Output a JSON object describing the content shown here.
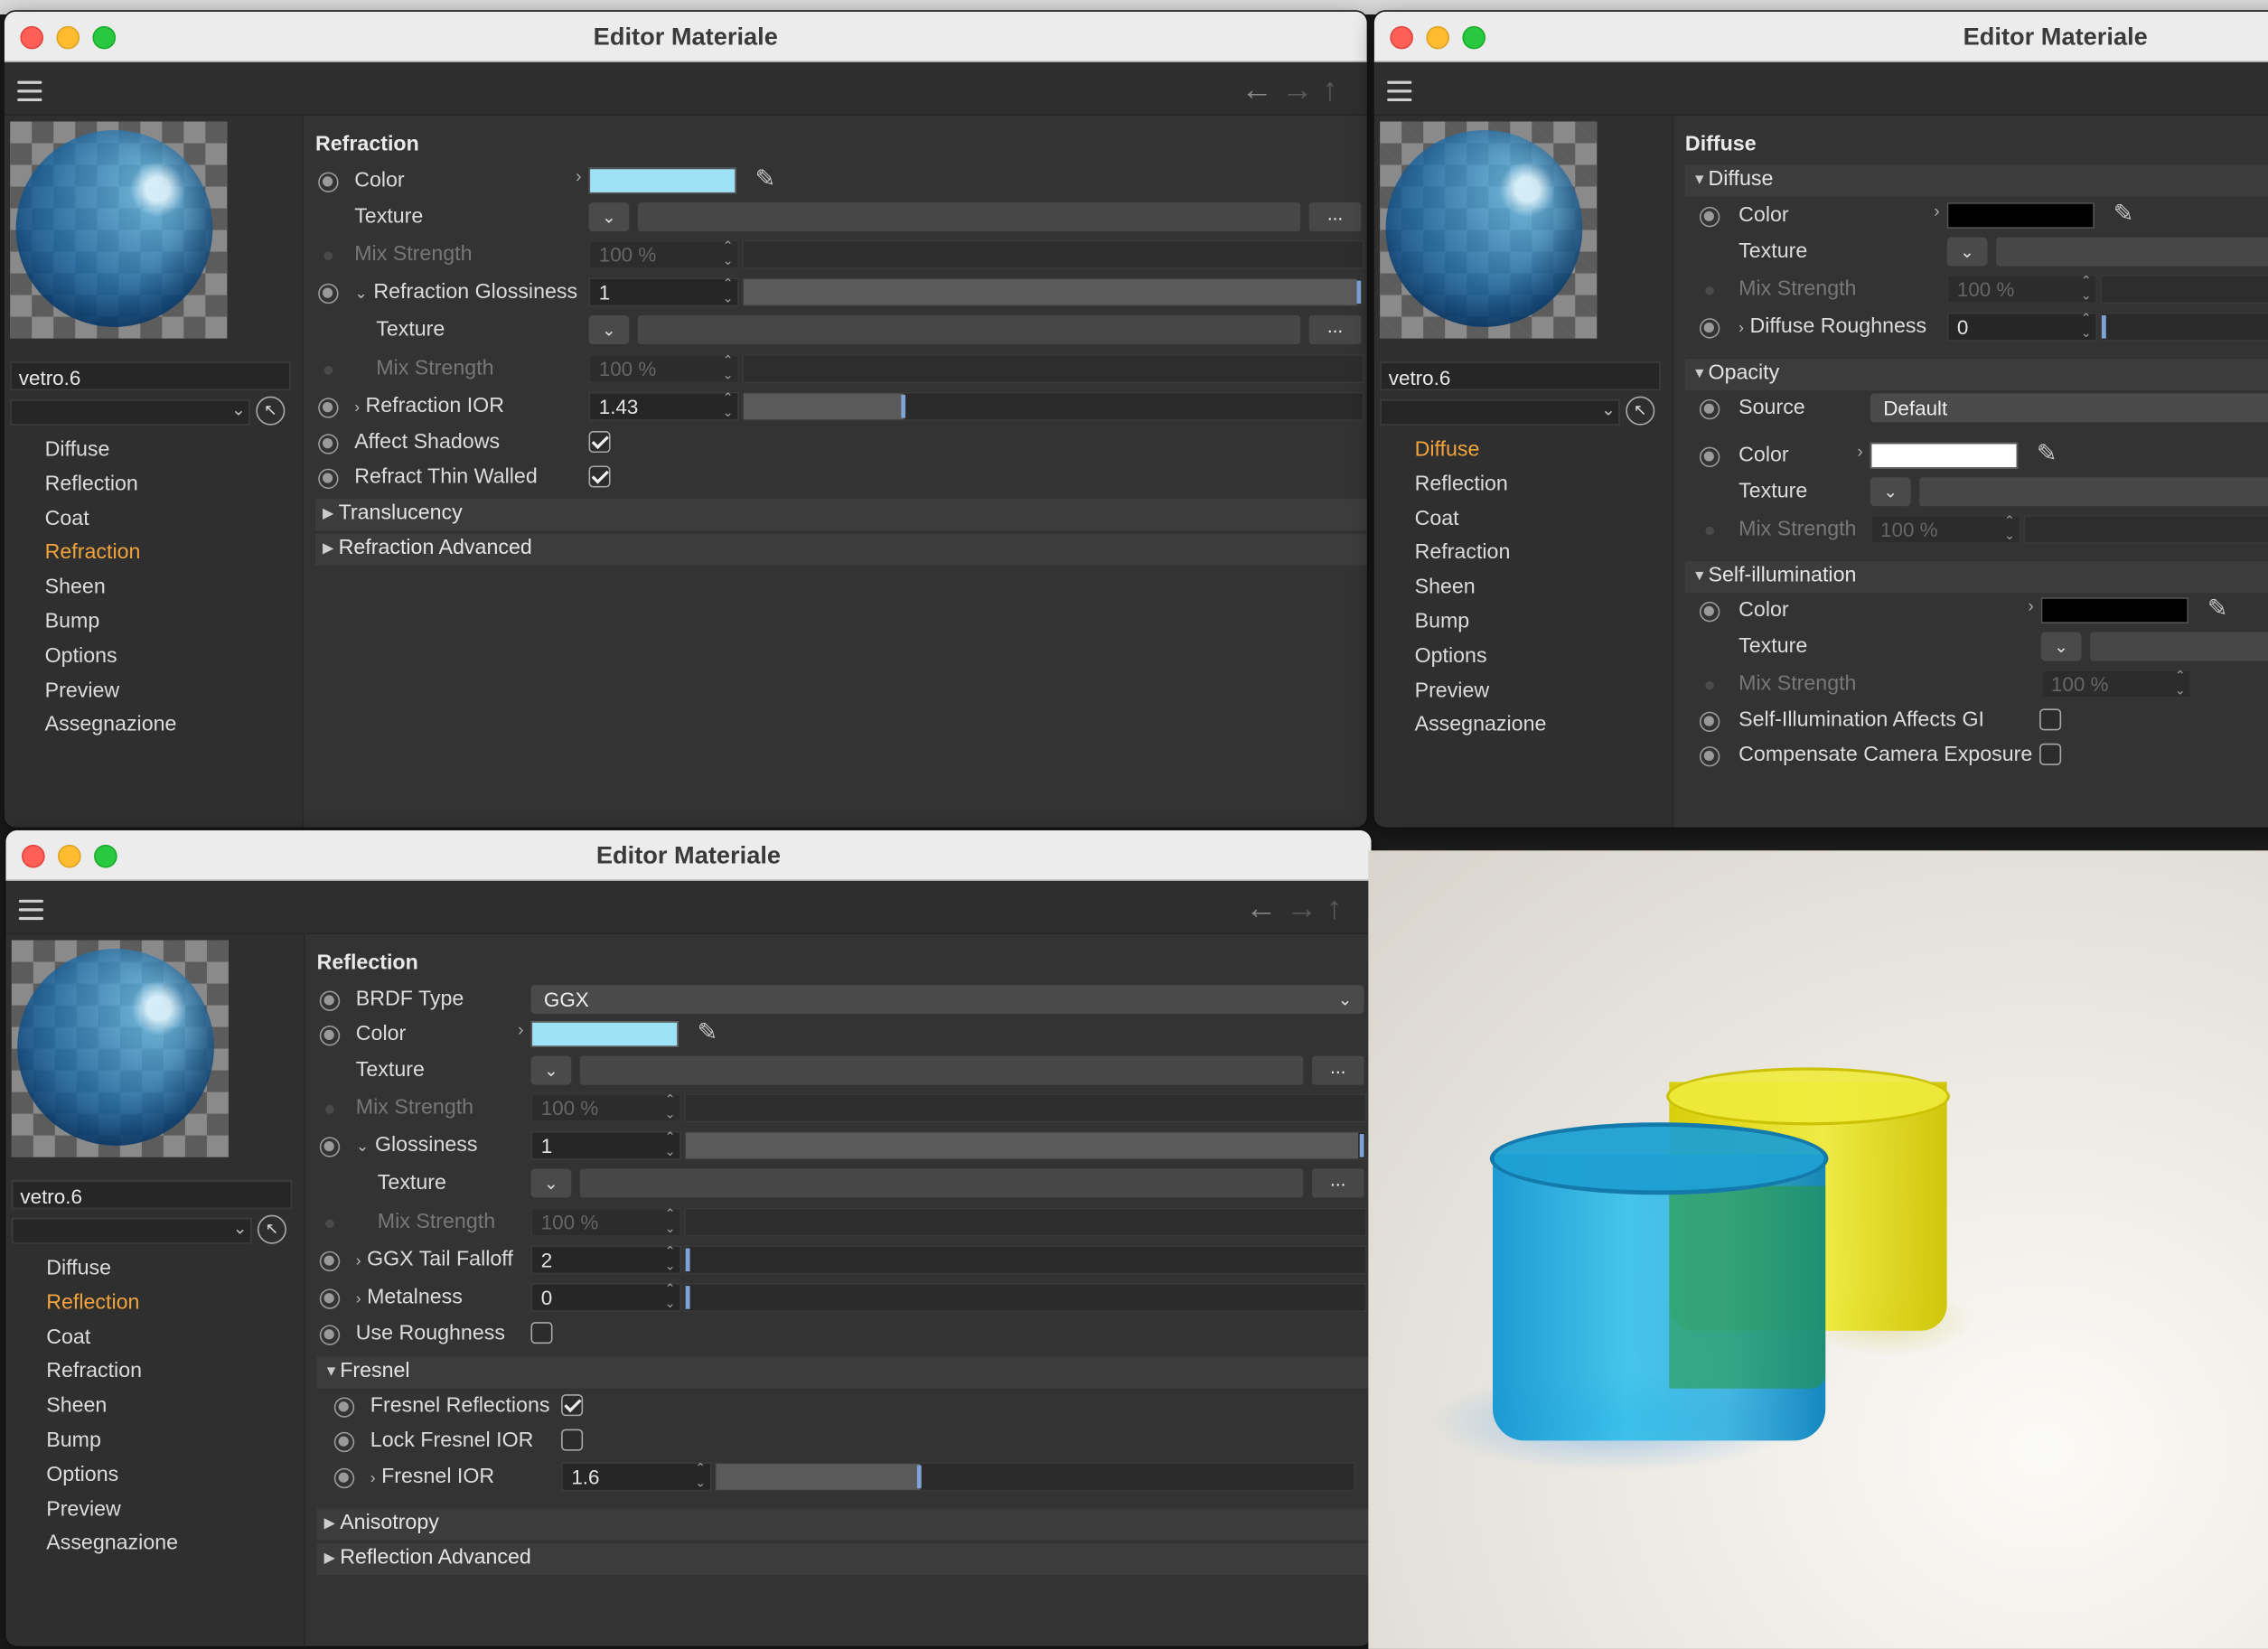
{
  "windows": {
    "refraction": {
      "title": "Editor Materiale",
      "material_name": "vetro.6",
      "channels": [
        "Diffuse",
        "Reflection",
        "Coat",
        "Refraction",
        "Sheen",
        "Bump",
        "Options",
        "Preview",
        "Assegnazione"
      ],
      "active_channel": "Refraction",
      "section_title": "Refraction",
      "color_label": "Color",
      "color_value": "#9fe2f5",
      "texture_label": "Texture",
      "mix_strength_label": "Mix Strength",
      "mix_strength_value": "100 %",
      "glossiness_label": "Refraction Glossiness",
      "glossiness_value": "1",
      "glossiness_texture_label": "Texture",
      "glossiness_mix_label": "Mix Strength",
      "glossiness_mix_value": "100 %",
      "ior_label": "Refraction IOR",
      "ior_value": "1.43",
      "ior_fill": 0.26,
      "affect_shadows_label": "Affect Shadows",
      "affect_shadows": true,
      "thin_walled_label": "Refract Thin Walled",
      "thin_walled": true,
      "groups": [
        "Translucency",
        "Refraction Advanced"
      ],
      "ellipsis": "..."
    },
    "diffuse": {
      "title": "Editor Materiale",
      "material_name": "vetro.6",
      "channels": [
        "Diffuse",
        "Reflection",
        "Coat",
        "Refraction",
        "Sheen",
        "Bump",
        "Options",
        "Preview",
        "Assegnazione"
      ],
      "active_channel": "Diffuse",
      "section_title": "Diffuse",
      "group_diffuse": "Diffuse",
      "color_label": "Color",
      "color_value": "#000000",
      "texture_label": "Texture",
      "mix_strength_label": "Mix Strength",
      "mix_strength_value": "100 %",
      "roughness_label": "Diffuse Roughness",
      "roughness_value": "0",
      "group_opacity": "Opacity",
      "source_label": "Source",
      "source_value": "Default",
      "opacity_color_label": "Color",
      "opacity_color_value": "#ffffff",
      "opacity_texture_label": "Texture",
      "opacity_mix_label": "Mix Strength",
      "opacity_mix_value": "100 %",
      "group_self": "Self-illumination",
      "self_color_label": "Color",
      "self_color_value": "#000000",
      "self_texture_label": "Texture",
      "self_mix_label": "Mix Strength",
      "self_mix_value": "100 %",
      "affects_gi_label": "Self-Illumination Affects GI",
      "affects_gi": false,
      "compensate_label": "Compensate Camera Exposure",
      "compensate": false
    },
    "reflection": {
      "title": "Editor Materiale",
      "material_name": "vetro.6",
      "channels": [
        "Diffuse",
        "Reflection",
        "Coat",
        "Refraction",
        "Sheen",
        "Bump",
        "Options",
        "Preview",
        "Assegnazione"
      ],
      "active_channel": "Reflection",
      "section_title": "Reflection",
      "brdf_label": "BRDF Type",
      "brdf_value": "GGX",
      "color_label": "Color",
      "color_value": "#9fe2f5",
      "texture_label": "Texture",
      "mix_strength_label": "Mix Strength",
      "mix_strength_value": "100 %",
      "glossiness_label": "Glossiness",
      "glossiness_value": "1",
      "gloss_texture_label": "Texture",
      "gloss_mix_label": "Mix Strength",
      "gloss_mix_value": "100 %",
      "tail_label": "GGX Tail Falloff",
      "tail_value": "2",
      "metalness_label": "Metalness",
      "metalness_value": "0",
      "use_roughness_label": "Use Roughness",
      "use_roughness": false,
      "group_fresnel": "Fresnel",
      "fresnel_reflections_label": "Fresnel Reflections",
      "fresnel_reflections": true,
      "lock_ior_label": "Lock Fresnel IOR",
      "lock_ior": false,
      "fresnel_ior_label": "Fresnel IOR",
      "fresnel_ior_value": "1.6",
      "fresnel_ior_fill": 0.32,
      "groups": [
        "Anisotropy",
        "Reflection Advanced"
      ],
      "ellipsis": "..."
    }
  }
}
